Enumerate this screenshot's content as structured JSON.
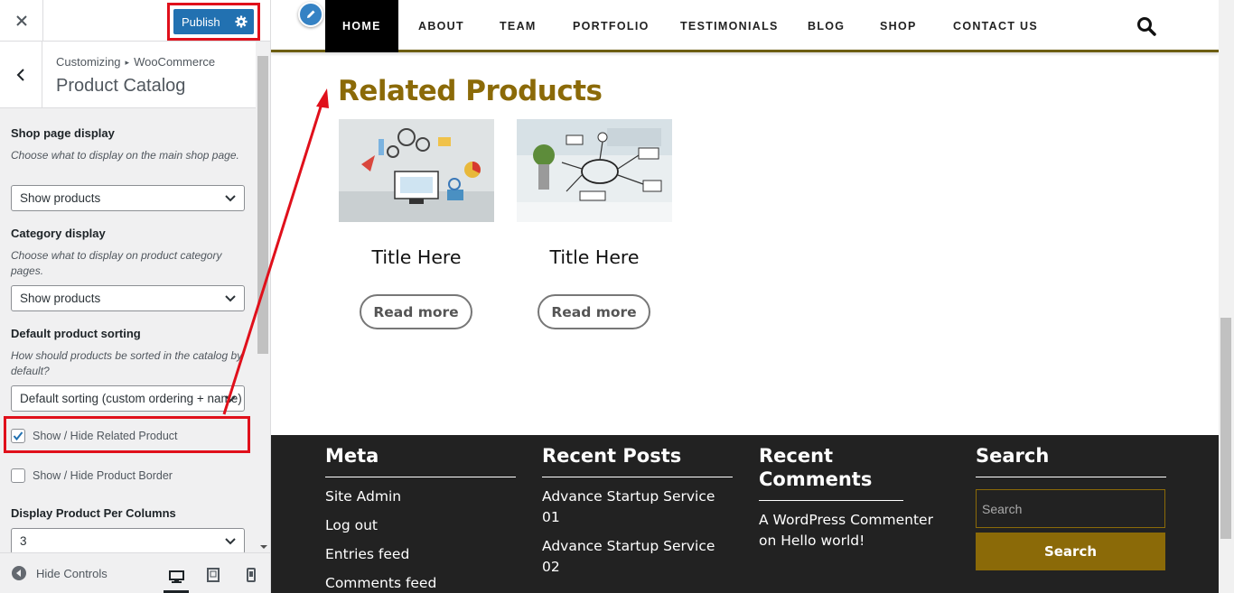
{
  "customizer": {
    "close_icon": "close-icon",
    "publish_label": "Publish",
    "breadcrumb": {
      "root": "Customizing",
      "separator": "▸",
      "parent": "WooCommerce"
    },
    "section_title": "Product Catalog",
    "controls": {
      "shop_page_display": {
        "label": "Shop page display",
        "description": "Choose what to display on the main shop page.",
        "value": "Show products"
      },
      "category_display": {
        "label": "Category display",
        "description": "Choose what to display on product category pages.",
        "value": "Show products"
      },
      "default_sorting": {
        "label": "Default product sorting",
        "description": "How should products be sorted in the catalog by default?",
        "value": "Default sorting (custom ordering + name)"
      },
      "show_related": {
        "label": "Show / Hide Related Product",
        "checked": true
      },
      "show_border": {
        "label": "Show / Hide Product Border",
        "checked": false
      },
      "per_columns": {
        "label": "Display Product Per Columns",
        "value": "3"
      }
    },
    "footer": {
      "hide_controls_label": "Hide Controls",
      "devices": [
        "desktop-icon",
        "tablet-icon",
        "mobile-icon"
      ],
      "active_device": "desktop"
    },
    "highlight_color": "#e0101b"
  },
  "preview": {
    "nav": {
      "items": [
        "HOME",
        "ABOUT",
        "TEAM",
        "PORTFOLIO",
        "TESTIMONIALS",
        "BLOG",
        "SHOP",
        "CONTACT US"
      ],
      "active": "HOME",
      "search_icon": "search-icon"
    },
    "related": {
      "title": "Related Products",
      "products": [
        {
          "title": "Title Here",
          "button": "Read more"
        },
        {
          "title": "Title Here",
          "button": "Read more"
        }
      ]
    },
    "footer": {
      "meta": {
        "title": "Meta",
        "links": [
          "Site Admin",
          "Log out",
          "Entries feed",
          "Comments feed"
        ]
      },
      "recent_posts": {
        "title": "Recent Posts",
        "links": [
          "Advance Startup Service 01",
          "Advance Startup Service 02"
        ]
      },
      "recent_comments": {
        "title": "Recent Comments",
        "text": "A WordPress Commenter on Hello world!"
      },
      "search": {
        "title": "Search",
        "placeholder": "Search",
        "button": "Search"
      }
    },
    "colors": {
      "accent": "#8b6a08",
      "footer_bg": "#222222",
      "nav_active_bg": "#000000"
    }
  }
}
